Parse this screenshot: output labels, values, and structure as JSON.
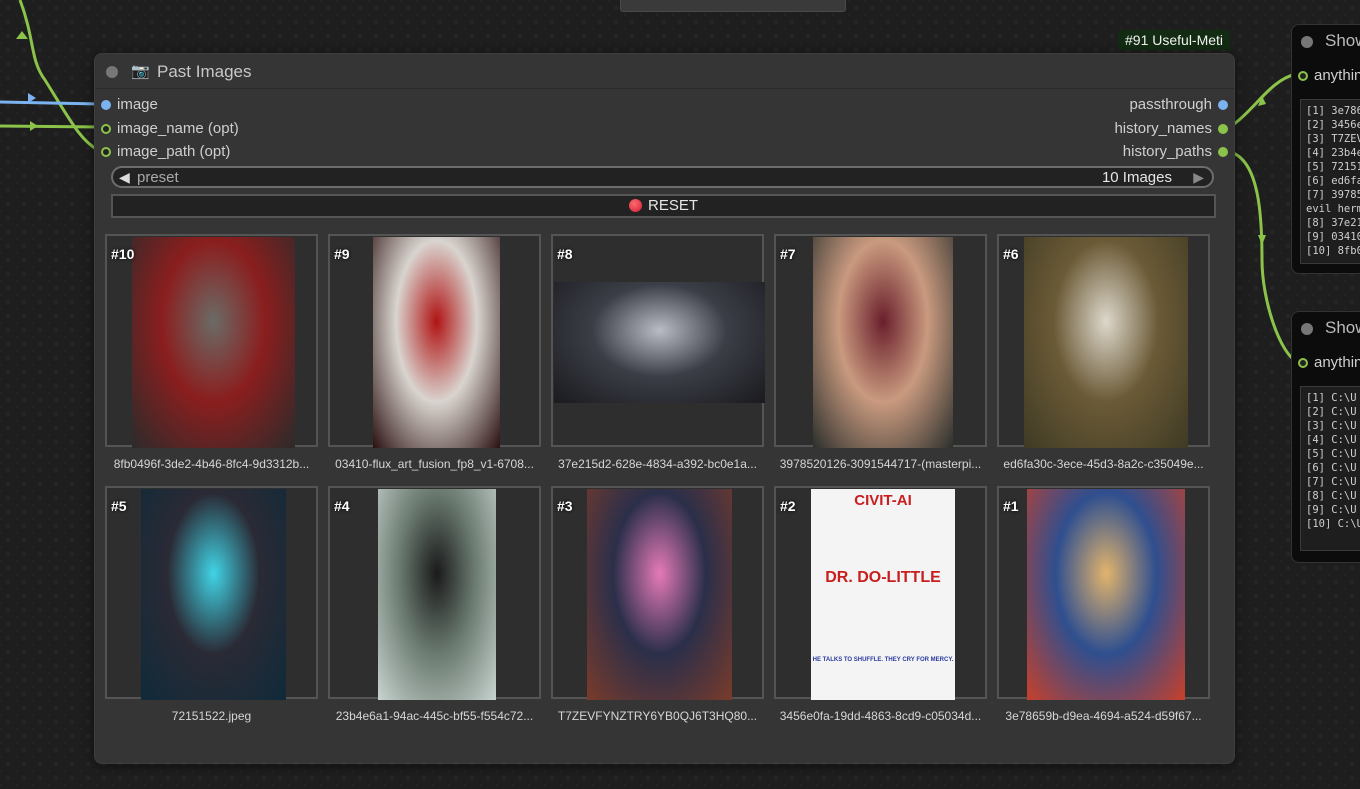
{
  "top_stub": {
    "label": ""
  },
  "node": {
    "badge": "#91 Useful-Meti",
    "icon": "camera-icon",
    "title": "Past Images",
    "inputs": [
      "image",
      "image_name (opt)",
      "image_path (opt)"
    ],
    "outputs": [
      "passthrough",
      "history_names",
      "history_paths"
    ],
    "preset": {
      "label": "preset",
      "value": "10 Images"
    },
    "reset_label": "RESET",
    "images": [
      {
        "num": "#10",
        "caption": "8fb0496f-3de2-4b46-8fc4-9d3312b...",
        "colors": [
          "#2b2b2b",
          "#6b6b66",
          "#8a1e1e"
        ]
      },
      {
        "num": "#9",
        "caption": "03410-flux_art_fusion_fp8_v1-6708...",
        "colors": [
          "#2a1010",
          "#b01414",
          "#d9d4cf"
        ]
      },
      {
        "num": "#8",
        "caption": "37e215d2-628e-4834-a392-bc0e1a...",
        "colors": [
          "#1a1a1f",
          "#b9bcc4",
          "#3b3e46"
        ]
      },
      {
        "num": "#7",
        "caption": "3978520126-3091544717-(masterpi...",
        "colors": [
          "#2b2f2c",
          "#6a1f2c",
          "#c99a7f"
        ]
      },
      {
        "num": "#6",
        "caption": "ed6fa30c-3ece-45d3-8a2c-c35049e...",
        "colors": [
          "#3e3a24",
          "#ddd8cc",
          "#6b5a36"
        ]
      },
      {
        "num": "#5",
        "caption": "72151522.jpeg",
        "colors": [
          "#0f2a3a",
          "#40d4e6",
          "#2a2a35"
        ]
      },
      {
        "num": "#4",
        "caption": "23b4e6a1-94ac-445c-bf55-f554c72...",
        "colors": [
          "#c9d4d0",
          "#1a1a1a",
          "#6a7a70"
        ]
      },
      {
        "num": "#3",
        "caption": "T7ZEVFYNZTRY6YB0QJ6T3HQ80...",
        "colors": [
          "#7a3b2a",
          "#e57ab8",
          "#2b2f4a"
        ]
      },
      {
        "num": "#2",
        "caption": "3456e0fa-19dd-4863-8cd9-c05034d...",
        "colors": [
          "#f4f4f4",
          "#c81e1e",
          "#1a1a1a"
        ],
        "poster_top": "CIVIT-AI",
        "poster_mid": "DR. DO-LITTLE",
        "poster_small": "HE TALKS TO SHUFFLE. THEY CRY FOR MERCY."
      },
      {
        "num": "#1",
        "caption": "3e78659b-d9ea-4694-a524-d59f67...",
        "colors": [
          "#c8402a",
          "#e2b46c",
          "#2f4f8f"
        ]
      }
    ]
  },
  "side_nodes": [
    {
      "title": "Show",
      "slot": "anythin",
      "lines": [
        "[1] 3e786",
        "[2] 3456e",
        "[3] T7ZEV",
        "[4] 23b4e",
        "[5] 72151",
        "[6] ed6fa",
        "[7] 39785",
        "evil herm",
        "[8] 37e21",
        "[9] 03410",
        "[10] 8fb0"
      ]
    },
    {
      "title": "Show",
      "slot": "anythin",
      "lines": [
        "[1] C:\\U",
        "[2] C:\\U",
        "[3] C:\\U",
        "[4] C:\\U",
        "[5] C:\\U",
        "[6] C:\\U",
        "[7] C:\\U",
        "[8] C:\\U",
        "[9] C:\\U",
        "[10] C:\\U"
      ]
    }
  ]
}
